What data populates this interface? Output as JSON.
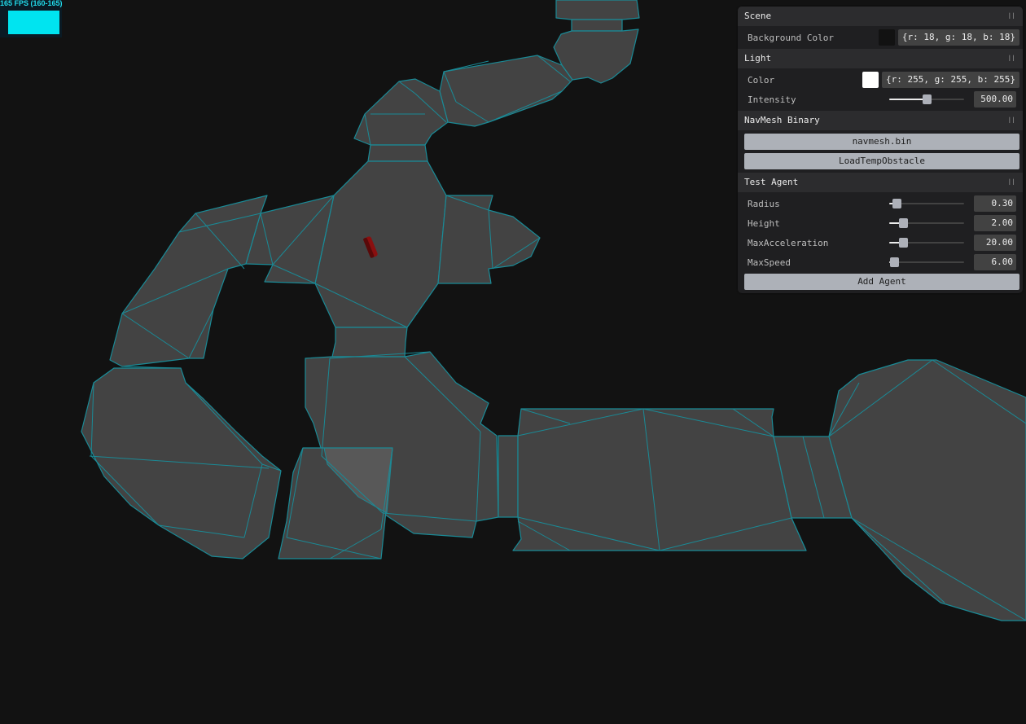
{
  "fps": {
    "label": "165 FPS (160-165)",
    "color": "#00e4f0"
  },
  "scene_colors": {
    "background": "#121212",
    "mesh_fill": "#434343",
    "mesh_edge": "#1a8a96",
    "agent": "#8a0f0f"
  },
  "gui": {
    "folders": [
      {
        "title": "Scene",
        "rows": [
          {
            "type": "color",
            "label": "Background Color",
            "swatch": "#121212",
            "value": "{r: 18, g: 18, b: 18}"
          }
        ]
      },
      {
        "title": "Light",
        "rows": [
          {
            "type": "color",
            "label": "Color",
            "swatch": "#ffffff",
            "value": "{r: 255, g: 255, b: 255}"
          },
          {
            "type": "slider",
            "label": "Intensity",
            "value": "500.00",
            "fraction": 0.5
          }
        ]
      },
      {
        "title": "NavMesh Binary",
        "rows": [
          {
            "type": "button",
            "label": "navmesh.bin"
          },
          {
            "type": "button",
            "label": "LoadTempObstacle"
          }
        ]
      },
      {
        "title": "Test Agent",
        "rows": [
          {
            "type": "slider",
            "label": "Radius",
            "value": "0.30",
            "fraction": 0.1
          },
          {
            "type": "slider",
            "label": "Height",
            "value": "2.00",
            "fraction": 0.19
          },
          {
            "type": "slider",
            "label": "MaxAcceleration",
            "value": "20.00",
            "fraction": 0.19
          },
          {
            "type": "slider",
            "label": "MaxSpeed",
            "value": "6.00",
            "fraction": 0.06
          },
          {
            "type": "button",
            "label": "Add Agent"
          }
        ]
      }
    ]
  }
}
